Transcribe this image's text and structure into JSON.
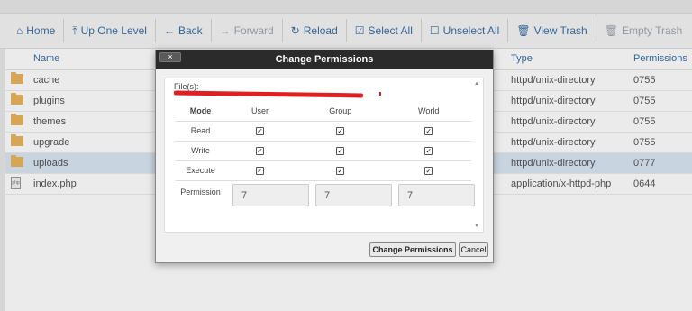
{
  "toolbar": {
    "items": [
      {
        "label": "Home",
        "icon": "⌂",
        "disabled": false
      },
      {
        "label": "Up One Level",
        "icon": "⤒",
        "disabled": false
      },
      {
        "label": "Back",
        "icon": "←",
        "disabled": false
      },
      {
        "label": "Forward",
        "icon": "→",
        "disabled": true
      },
      {
        "label": "Reload",
        "icon": "↻",
        "disabled": false
      },
      {
        "label": "Select All",
        "icon": "☑",
        "disabled": false
      },
      {
        "label": "Unselect All",
        "icon": "☐",
        "disabled": false
      },
      {
        "label": "View Trash",
        "icon": "🗑",
        "disabled": false
      },
      {
        "label": "Empty Trash",
        "icon": "🗑",
        "disabled": true
      }
    ]
  },
  "filelist": {
    "headers": {
      "name": "Name",
      "type": "Type",
      "permissions": "Permissions"
    },
    "rows": [
      {
        "name": "cache",
        "type": "httpd/unix-directory",
        "perms": "0755",
        "kind": "folder"
      },
      {
        "name": "plugins",
        "type": "httpd/unix-directory",
        "perms": "0755",
        "kind": "folder"
      },
      {
        "name": "themes",
        "type": "httpd/unix-directory",
        "perms": "0755",
        "kind": "folder"
      },
      {
        "name": "upgrade",
        "type": "httpd/unix-directory",
        "perms": "0755",
        "kind": "folder"
      },
      {
        "name": "uploads",
        "type": "httpd/unix-directory",
        "perms": "0777",
        "kind": "folder",
        "selected": true
      },
      {
        "name": "index.php",
        "type": "application/x-httpd-php",
        "perms": "0644",
        "kind": "file"
      }
    ]
  },
  "dialog": {
    "title": "Change Permissions",
    "close": "×",
    "files_label": "File(s):",
    "headers": {
      "mode": "Mode",
      "user": "User",
      "group": "Group",
      "world": "World"
    },
    "rows": [
      {
        "label": "Read",
        "user": true,
        "group": true,
        "world": true
      },
      {
        "label": "Write",
        "user": true,
        "group": true,
        "world": true
      },
      {
        "label": "Execute",
        "user": true,
        "group": true,
        "world": true
      }
    ],
    "permission_label": "Permission",
    "permission_values": {
      "user": "7",
      "group": "7",
      "world": "7"
    },
    "change_button": "Change Permissions",
    "cancel_button": "Cancel"
  },
  "colors": {
    "link": "#3a6ea5",
    "titlebar": "#2b2b2b",
    "folder": "#e9b35d",
    "selected_row": "#d9e6f2",
    "redaction": "#e02020"
  }
}
